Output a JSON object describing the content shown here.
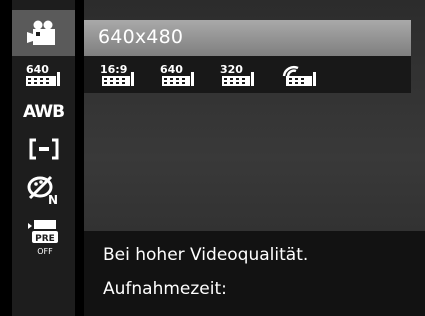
{
  "sidebar": {
    "items": [
      {
        "name": "video-mode-icon",
        "label": ""
      },
      {
        "name": "resolution-640-icon",
        "label": "640"
      },
      {
        "name": "awb-icon",
        "label": "AWB"
      },
      {
        "name": "focus-frame-icon",
        "label": ""
      },
      {
        "name": "color-effect-icon",
        "label": "N"
      },
      {
        "name": "pre-record-icon",
        "label": "PRE",
        "state": "OFF"
      }
    ],
    "selected_index": 0
  },
  "menu": {
    "title": "640x480",
    "options": [
      {
        "name": "resolution-169-option",
        "label": "16:9"
      },
      {
        "name": "resolution-640-option",
        "label": "640"
      },
      {
        "name": "resolution-320-option",
        "label": "320"
      },
      {
        "name": "resolution-web-option",
        "label": ""
      }
    ]
  },
  "info": {
    "line1": "Bei hoher Videoqualität.",
    "line2": "Aufnahmezeit:"
  },
  "colors": {
    "header_gradient_top": "#a9a9a9",
    "header_gradient_bottom": "#7f7f7f",
    "sidebar_bg": "#1d1d1d",
    "sidebar_selected": "#5a5a5a"
  }
}
